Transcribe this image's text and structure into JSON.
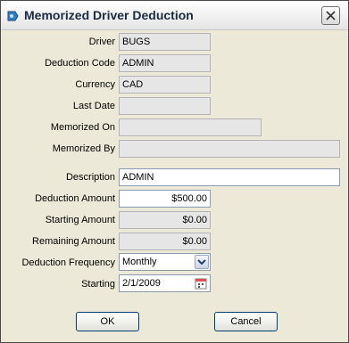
{
  "window": {
    "title": "Memorized Driver Deduction"
  },
  "form": {
    "driver": {
      "label": "Driver",
      "value": "BUGS"
    },
    "deduction_code": {
      "label": "Deduction Code",
      "value": "ADMIN"
    },
    "currency": {
      "label": "Currency",
      "value": "CAD"
    },
    "last_date": {
      "label": "Last Date",
      "value": ""
    },
    "memorized_on": {
      "label": "Memorized On",
      "value": ""
    },
    "memorized_by": {
      "label": "Memorized By",
      "value": ""
    },
    "description": {
      "label": "Description",
      "value": "ADMIN"
    },
    "deduction_amount": {
      "label": "Deduction Amount",
      "value": "$500.00"
    },
    "starting_amount": {
      "label": "Starting Amount",
      "value": "$0.00"
    },
    "remaining_amount": {
      "label": "Remaining Amount",
      "value": "$0.00"
    },
    "deduction_frequency": {
      "label": "Deduction Frequency",
      "value": "Monthly"
    },
    "starting": {
      "label": "Starting",
      "value": "2/1/2009"
    }
  },
  "buttons": {
    "ok": "OK",
    "cancel": "Cancel"
  },
  "icons": {
    "app": "app-icon",
    "close": "close-icon",
    "dropdown": "chevron-down-icon",
    "calendar": "calendar-icon"
  }
}
